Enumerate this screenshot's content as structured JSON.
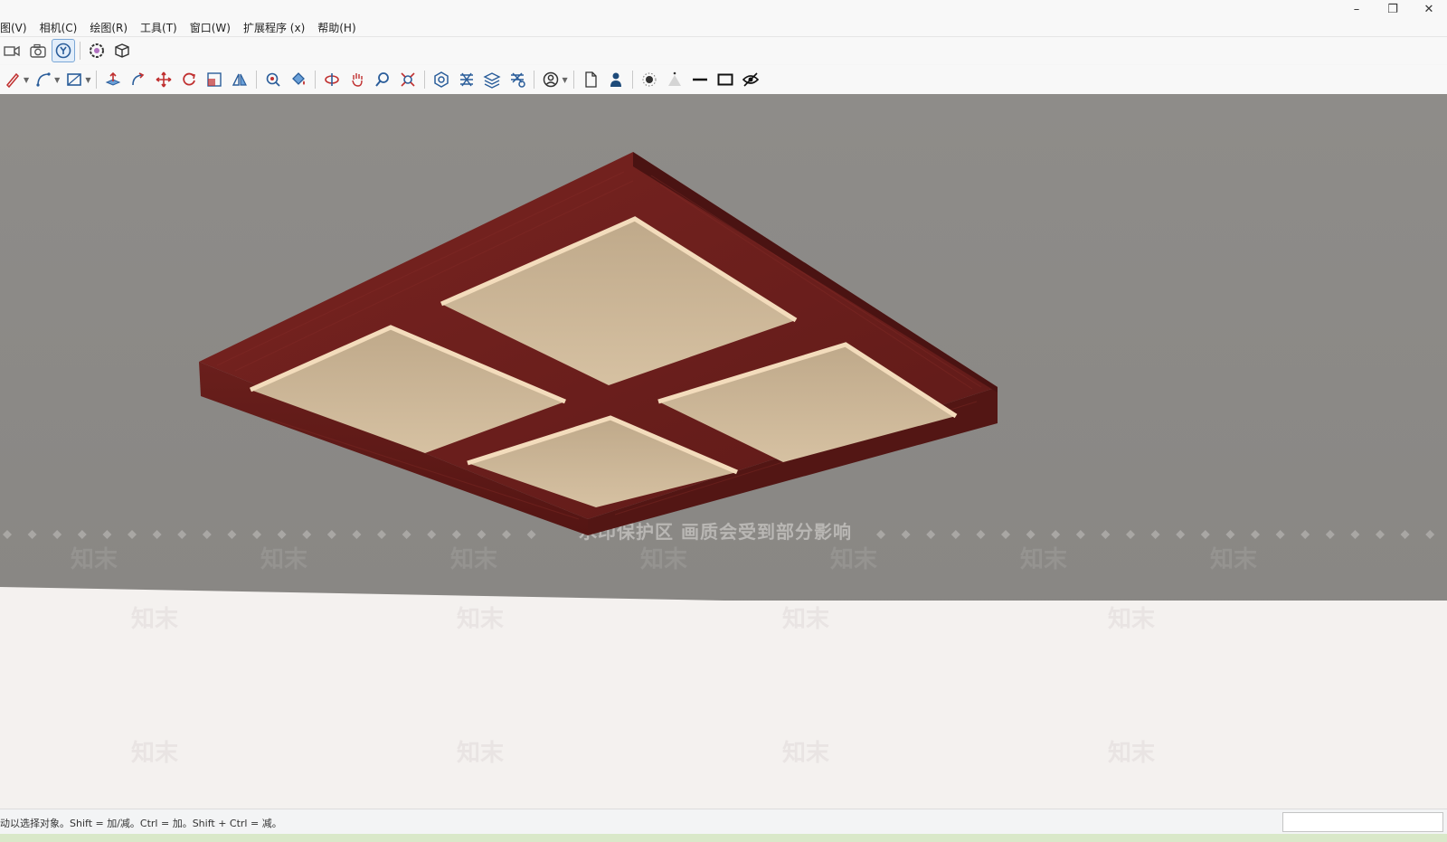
{
  "menu": {
    "items": [
      "图(V)",
      "相机(C)",
      "绘图(R)",
      "工具(T)",
      "窗口(W)",
      "扩展程序 (x)",
      "帮助(H)"
    ]
  },
  "window_controls": {
    "minimize": "–",
    "restore": "❐",
    "close": "✕"
  },
  "viewport": {
    "watermark_notice": "水印保护区  画质会受到部分影响",
    "watermark_brand": "知末"
  },
  "status": {
    "hint": "动以选择对象。Shift = 加/减。Ctrl = 加。Shift + Ctrl = 减。",
    "measurements_value": ""
  },
  "colors": {
    "wood": "#6e1f1c",
    "panel": "#c9b394",
    "panel_glow": "#f3dcbc",
    "background": "#8e8c89",
    "floor": "#f4f1ef"
  }
}
